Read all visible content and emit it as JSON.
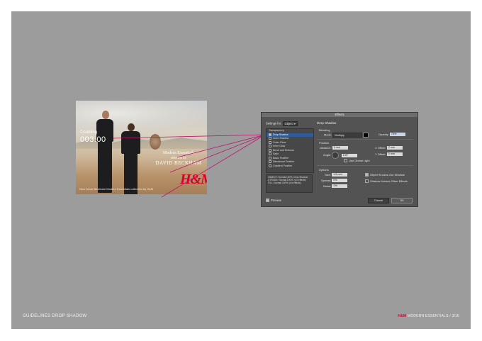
{
  "footer": {
    "left": "GUIDELINES DROP SHADOW",
    "right_brand": "H&M",
    "right_text": "MODERN ESSENTIALS / 3/16"
  },
  "photo": {
    "counter_label": "Counting",
    "counter": "003.00",
    "title_line1": "Modern Essentials",
    "title_line2": "selected by",
    "title_line3": "DAVID BECKHAM",
    "logo": "H&M",
    "caption": "New David Beckham Modern Essentials collection by H&M"
  },
  "dialog": {
    "title": "Effects",
    "settings_label": "Settings for:",
    "settings_value": "Object",
    "list_header": "Transparency",
    "effects": [
      {
        "label": "Drop Shadow",
        "checked": true,
        "active": true
      },
      {
        "label": "Inner Shadow",
        "checked": false,
        "active": false
      },
      {
        "label": "Outer Glow",
        "checked": false,
        "active": false
      },
      {
        "label": "Inner Glow",
        "checked": false,
        "active": false
      },
      {
        "label": "Bevel and Emboss",
        "checked": false,
        "active": false
      },
      {
        "label": "Satin",
        "checked": false,
        "active": false
      },
      {
        "label": "Basic Feather",
        "checked": false,
        "active": false
      },
      {
        "label": "Directional Feather",
        "checked": false,
        "active": false
      },
      {
        "label": "Gradient Feather",
        "checked": false,
        "active": false
      }
    ],
    "summary": "OBJECT: Normal 100%; Drop Shadow STROKE: Normal 100%; (no effects) FILL: Normal 100%; (no effects)",
    "preview_label": "Preview",
    "section_title": "Drop Shadow",
    "blending": {
      "title": "Blending",
      "mode_label": "Mode:",
      "mode_value": "Multiply",
      "opacity_label": "Opacity:",
      "opacity_value": "75%"
    },
    "position": {
      "title": "Position",
      "distance_label": "Distance:",
      "distance_value": "2 mm",
      "x_offset_label": "X Offset:",
      "x_offset_value": "2 mm",
      "angle_label": "Angle:",
      "angle_value": "135°",
      "y_offset_label": "Y Offset:",
      "y_offset_value": "0 mm",
      "global_light_label": "Use Global Light"
    },
    "options": {
      "title": "Options",
      "size_label": "Size:",
      "size_value": "1.5 mm",
      "spread_label": "Spread:",
      "spread_value": "0%",
      "noise_label": "Noise:",
      "noise_value": "0%",
      "knocks_out_label": "Object Knocks Out Shadow",
      "honors_label": "Shadow Honors Other Effects"
    },
    "cancel_label": "Cancel",
    "ok_label": "OK"
  }
}
